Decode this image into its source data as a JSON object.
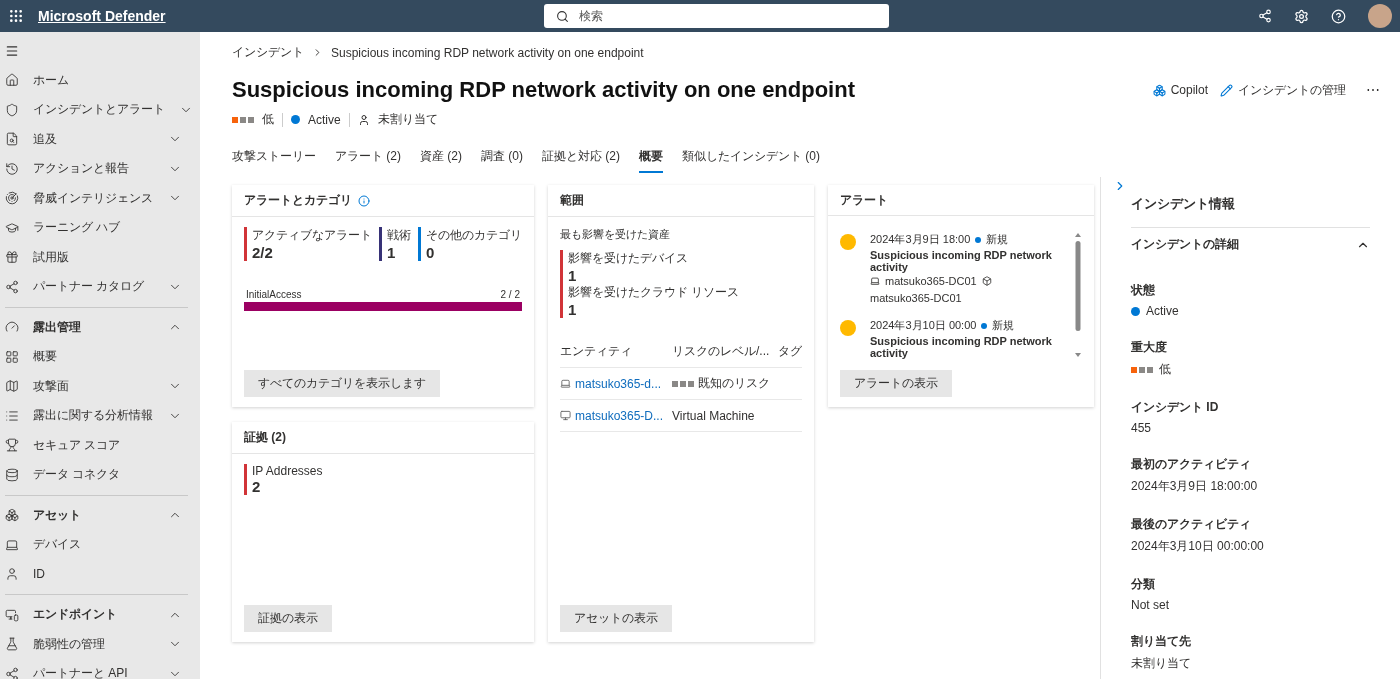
{
  "topbar": {
    "app_name": "Microsoft Defender",
    "search": {
      "placeholder": "検索"
    }
  },
  "sidebar": {
    "items": [
      {
        "kind": "item",
        "label": "ホーム"
      },
      {
        "kind": "group",
        "label": "インシデントとアラート",
        "expanded": false
      },
      {
        "kind": "group",
        "label": "追及",
        "expanded": false
      },
      {
        "kind": "group",
        "label": "アクションと報告",
        "expanded": false
      },
      {
        "kind": "group",
        "label": "脅威インテリジェンス",
        "expanded": false
      },
      {
        "kind": "item",
        "label": "ラーニング ハブ"
      },
      {
        "kind": "item",
        "label": "試用版"
      },
      {
        "kind": "group",
        "label": "パートナー カタログ",
        "expanded": false
      },
      {
        "kind": "section",
        "label": "露出管理",
        "expanded": true
      },
      {
        "kind": "item",
        "label": "概要"
      },
      {
        "kind": "group",
        "label": "攻撃面",
        "expanded": false
      },
      {
        "kind": "group",
        "label": "露出に関する分析情報",
        "expanded": false
      },
      {
        "kind": "item",
        "label": "セキュア スコア"
      },
      {
        "kind": "item",
        "label": "データ コネクタ"
      },
      {
        "kind": "section",
        "label": "アセット",
        "expanded": true
      },
      {
        "kind": "item",
        "label": "デバイス"
      },
      {
        "kind": "item",
        "label": "ID"
      },
      {
        "kind": "section",
        "label": "エンドポイント",
        "expanded": true
      },
      {
        "kind": "group",
        "label": "脆弱性の管理",
        "expanded": false
      },
      {
        "kind": "group",
        "label": "パートナーと API",
        "expanded": false
      }
    ]
  },
  "breadcrumb": [
    "インシデント",
    "Suspicious incoming RDP network activity on one endpoint"
  ],
  "title": "Suspicious incoming RDP network activity on one endpoint",
  "actions": {
    "copilot": "Copilot",
    "manage": "インシデントの管理",
    "more": "⋯"
  },
  "meta": {
    "severity": "低",
    "status": "Active",
    "assignee": "未割り当て"
  },
  "tabs": [
    {
      "label": "攻撃ストーリー",
      "selected": false
    },
    {
      "label": "アラート (2)",
      "selected": false
    },
    {
      "label": "資産 (2)",
      "selected": false
    },
    {
      "label": "調査 (0)",
      "selected": false
    },
    {
      "label": "証拠と対応 (2)",
      "selected": false
    },
    {
      "label": "概要",
      "selected": true
    },
    {
      "label": "類似したインシデント (0)",
      "selected": false
    }
  ],
  "alerts_categories": {
    "title": "アラートとカテゴリ",
    "stats": [
      {
        "label": "アクティブなアラート",
        "value": "2/2",
        "color": "#d13438"
      },
      {
        "label": "戦術",
        "value": "1",
        "color": "#373277"
      },
      {
        "label": "その他のカテゴリ",
        "value": "0",
        "color": "#0078d4"
      }
    ],
    "bars": [
      {
        "label": "InitialAccess",
        "count": "2 / 2",
        "level": 1
      }
    ],
    "button": "すべてのカテゴリを表示します"
  },
  "evidence": {
    "title": "証拠 (2)",
    "stats": [
      {
        "label": "IP Addresses",
        "value": "2"
      }
    ],
    "button": "証拠の表示"
  },
  "scope": {
    "title": "範囲",
    "subtitle": "最も影響を受けた資産",
    "stats": [
      {
        "label": "影響を受けたデバイス",
        "value": "1"
      },
      {
        "label": "影響を受けたクラウド リソース",
        "value": "1"
      }
    ],
    "columns": [
      "エンティティ",
      "リスクのレベル/...",
      "タグ"
    ],
    "rows": [
      {
        "kind": "laptop",
        "entity": "matsuko365-d...",
        "risk": "既知のリスク"
      },
      {
        "kind": "vm",
        "entity": "matsuko365-D...",
        "risk": "Virtual Machine"
      }
    ],
    "button": "アセットの表示"
  },
  "alerts": {
    "title": "アラート",
    "items": [
      {
        "time": "2024年3月9日 18:00",
        "status": "新規",
        "title": "Suspicious incoming RDP network activity",
        "device": "matsuko365-DC01",
        "resource": "matsuko365-DC01"
      },
      {
        "time": "2024年3月10日 00:00",
        "status": "新規",
        "title": "Suspicious incoming RDP network activity"
      }
    ],
    "button": "アラートの表示"
  },
  "info": {
    "title": "インシデント情報",
    "section": "インシデントの詳細",
    "expanded": true,
    "fields": [
      {
        "kind": "status",
        "label": "状態",
        "value": "Active"
      },
      {
        "kind": "severity",
        "label": "重大度",
        "value": "低"
      },
      {
        "kind": "text",
        "label": "インシデント ID",
        "value": "455"
      },
      {
        "kind": "text",
        "label": "最初のアクティビティ",
        "value": "2024年3月9日 18:00:00"
      },
      {
        "kind": "text",
        "label": "最後のアクティビティ",
        "value": "2024年3月10日 00:00:00"
      },
      {
        "kind": "text",
        "label": "分類",
        "value": "Not set"
      },
      {
        "kind": "text",
        "label": "割り当て先",
        "value": "未割り当て"
      }
    ]
  }
}
